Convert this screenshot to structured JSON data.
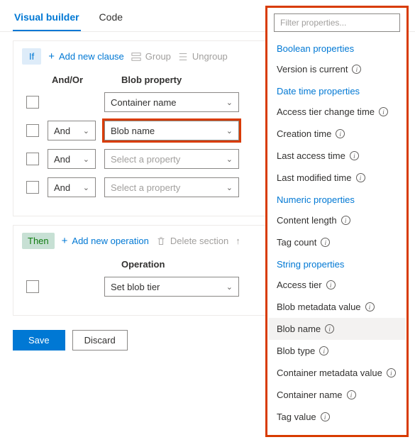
{
  "tabs": {
    "visual": "Visual builder",
    "code": "Code"
  },
  "ifSection": {
    "label": "If",
    "addClause": "Add new clause",
    "group": "Group",
    "ungroup": "Ungroup",
    "colAndOr": "And/Or",
    "colProp": "Blob property",
    "rows": [
      {
        "andor": "",
        "prop": "Container name"
      },
      {
        "andor": "And",
        "prop": "Blob name"
      },
      {
        "andor": "And",
        "prop": "Select a property"
      },
      {
        "andor": "And",
        "prop": "Select a property"
      }
    ]
  },
  "thenSection": {
    "label": "Then",
    "addOp": "Add new operation",
    "delSection": "Delete section",
    "colOp": "Operation",
    "opValue": "Set blob tier"
  },
  "footer": {
    "save": "Save",
    "discard": "Discard"
  },
  "panel": {
    "filterPlaceholder": "Filter properties...",
    "groups": [
      {
        "title": "Boolean properties",
        "items": [
          "Version is current"
        ]
      },
      {
        "title": "Date time properties",
        "items": [
          "Access tier change time",
          "Creation time",
          "Last access time",
          "Last modified time"
        ]
      },
      {
        "title": "Numeric properties",
        "items": [
          "Content length",
          "Tag count"
        ]
      },
      {
        "title": "String properties",
        "items": [
          "Access tier",
          "Blob metadata value",
          "Blob name",
          "Blob type",
          "Container metadata value",
          "Container name",
          "Tag value"
        ]
      }
    ],
    "selected": "Blob name"
  }
}
